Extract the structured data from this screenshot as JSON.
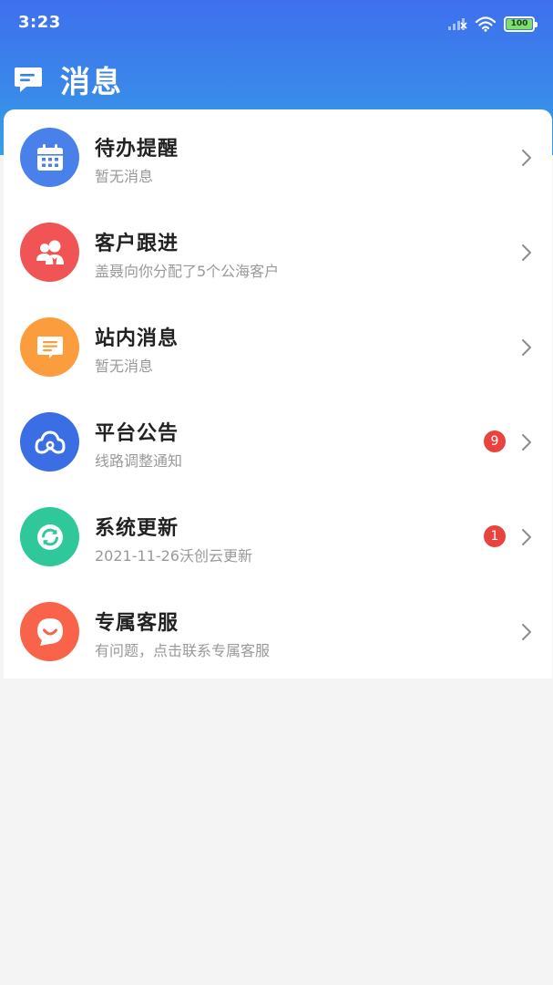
{
  "status_bar": {
    "time": "3:23",
    "battery": "100",
    "icons": [
      "signal-icon",
      "wifi-icon",
      "battery-icon"
    ]
  },
  "header": {
    "title": "消息",
    "icon": "chat-bubble-icon"
  },
  "colors": {
    "header_gradient_top": "#3e70ee",
    "header_gradient_bottom": "#35a0e6",
    "badge": "#e9433f"
  },
  "items": [
    {
      "title": "待办提醒",
      "subtitle": "暂无消息",
      "icon": "calendar-icon",
      "color": "#4a80ea"
    },
    {
      "title": "客户跟进",
      "subtitle": "盖聂向你分配了5个公海客户",
      "icon": "customer-icon",
      "color": "#f05454"
    },
    {
      "title": "站内消息",
      "subtitle": "暂无消息",
      "icon": "message-icon",
      "color": "#fb9d3c"
    },
    {
      "title": "平台公告",
      "subtitle": "线路调整通知",
      "icon": "cloud-link-icon",
      "color": "#3b6de4",
      "badge": "9"
    },
    {
      "title": "系统更新",
      "subtitle": "2021-11-26沃创云更新",
      "icon": "refresh-icon",
      "color": "#2fc89a",
      "badge": "1"
    },
    {
      "title": "专属客服",
      "subtitle": "有问题，点击联系专属客服",
      "icon": "smile-icon",
      "color": "#f8634a"
    }
  ]
}
